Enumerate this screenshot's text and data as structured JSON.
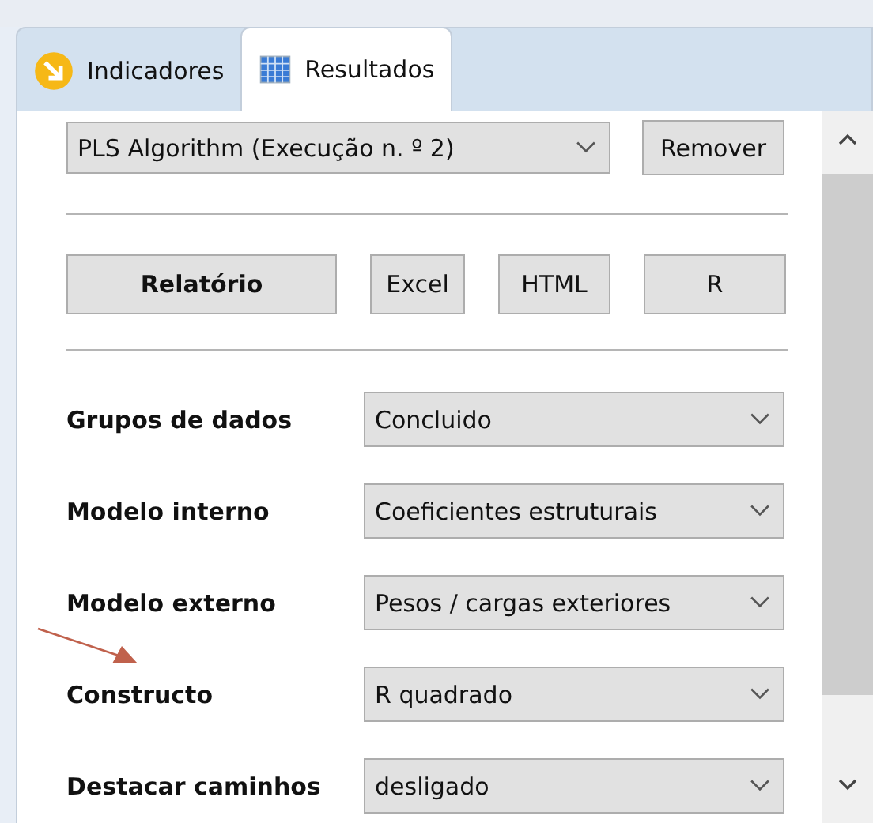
{
  "tabs": [
    {
      "label": "Indicadores",
      "kind": "indicators",
      "selected": false
    },
    {
      "label": "Resultados",
      "kind": "results",
      "selected": true
    }
  ],
  "run_select": {
    "value": "PLS Algorithm (Execução n. º 2)"
  },
  "remove_button": "Remover",
  "export_buttons": [
    {
      "label": "Relatório",
      "kind": "primary"
    },
    {
      "label": "Excel",
      "kind": "plain"
    },
    {
      "label": "HTML",
      "kind": "plain"
    },
    {
      "label": "R",
      "kind": "plain"
    }
  ],
  "settings": [
    {
      "label": "Grupos de dados",
      "value": "Concluido"
    },
    {
      "label": "Modelo interno",
      "value": "Coeficientes estruturais"
    },
    {
      "label": "Modelo externo",
      "value": "Pesos / cargas exteriores"
    },
    {
      "label": "Constructo",
      "value": "R quadrado"
    },
    {
      "label": "Destacar caminhos",
      "value": "desligado"
    }
  ]
}
